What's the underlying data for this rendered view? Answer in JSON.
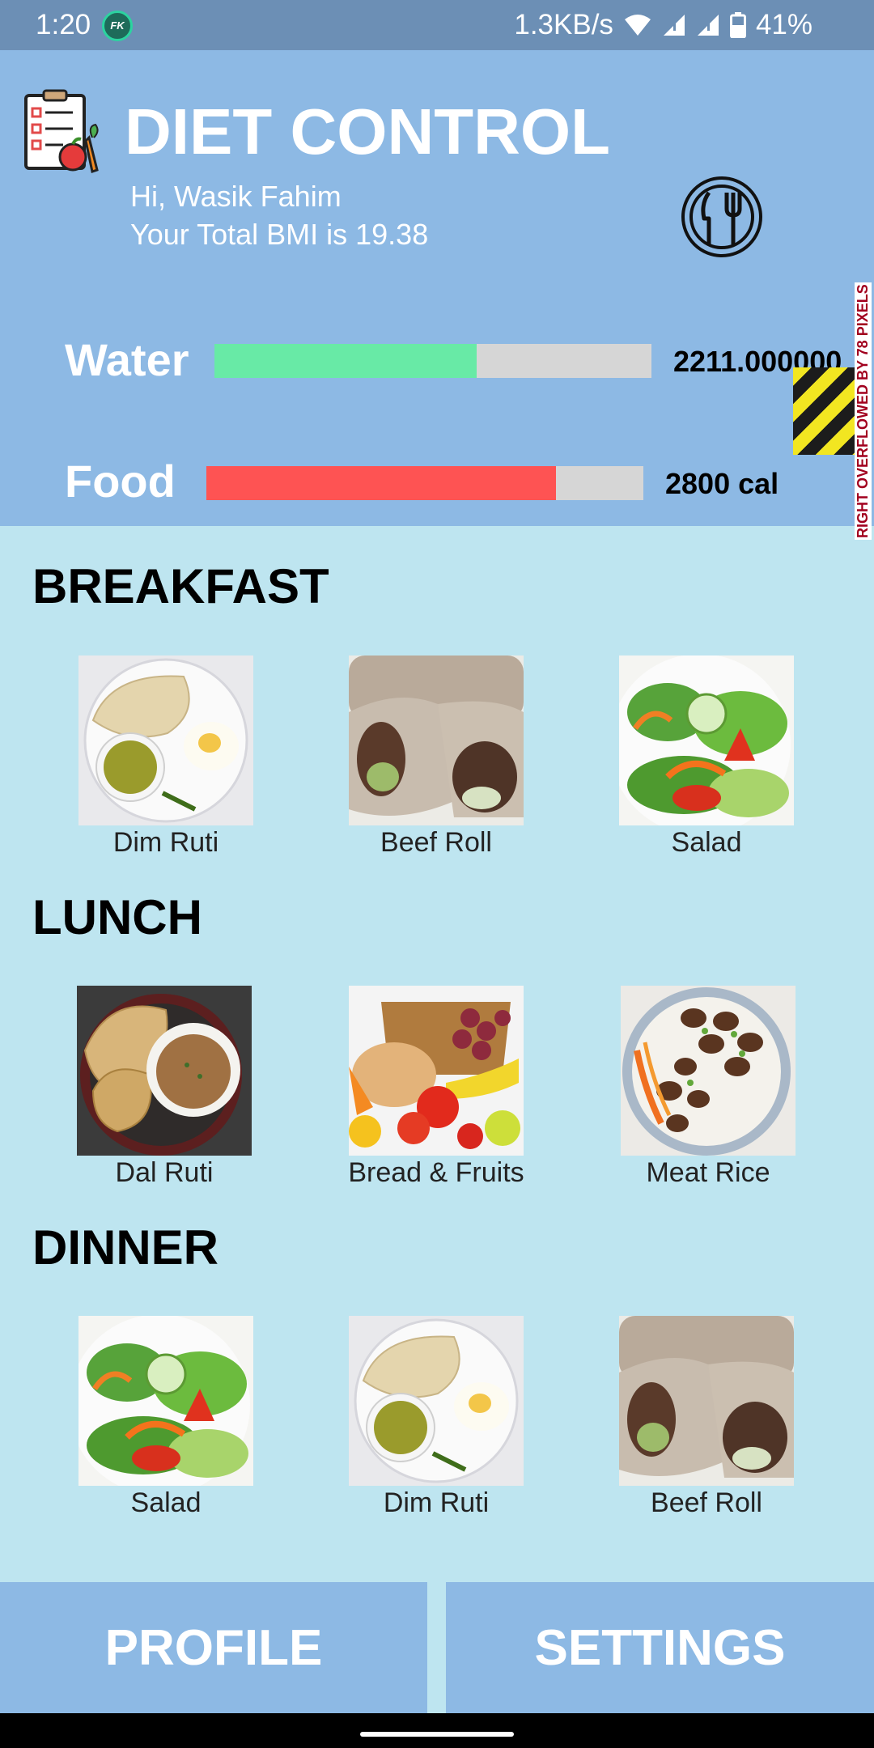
{
  "status_bar": {
    "time": "1:20",
    "app_badge": "FK",
    "network_speed": "1.3KB/s",
    "battery": "41%"
  },
  "header": {
    "title": "DIET CONTROL",
    "greeting": "Hi, Wasik Fahim",
    "bmi_text": "Your Total BMI is 19.38",
    "logo_icon": "diet-checklist-icon",
    "restaurant_icon": "plate-fork-knife-icon"
  },
  "meters": {
    "water": {
      "label": "Water",
      "value_text": "2211.000000",
      "fill_fraction": 0.6,
      "color": "#68eaa6"
    },
    "food": {
      "label": "Food",
      "value_text": "2800 cal",
      "fill_fraction": 0.8,
      "color": "#fe5353"
    }
  },
  "overflow_warning": "RIGHT OVERFLOWED BY 78 PIXELS",
  "sections": {
    "breakfast": {
      "title": "BREAKFAST",
      "items": [
        {
          "label": "Dim Ruti"
        },
        {
          "label": "Beef Roll"
        },
        {
          "label": "Salad"
        }
      ]
    },
    "lunch": {
      "title": "LUNCH",
      "items": [
        {
          "label": "Dal Ruti"
        },
        {
          "label": "Bread & Fruits"
        },
        {
          "label": "Meat Rice"
        }
      ]
    },
    "dinner": {
      "title": "DINNER",
      "items": [
        {
          "label": "Salad"
        },
        {
          "label": "Dim Ruti"
        },
        {
          "label": "Beef Roll"
        }
      ]
    }
  },
  "buttons": {
    "profile": "PROFILE",
    "settings": "SETTINGS"
  },
  "colors": {
    "header_bg": "#8db9e4",
    "body_bg": "#bee5f0",
    "status_bar_bg": "#6c8fb5"
  }
}
